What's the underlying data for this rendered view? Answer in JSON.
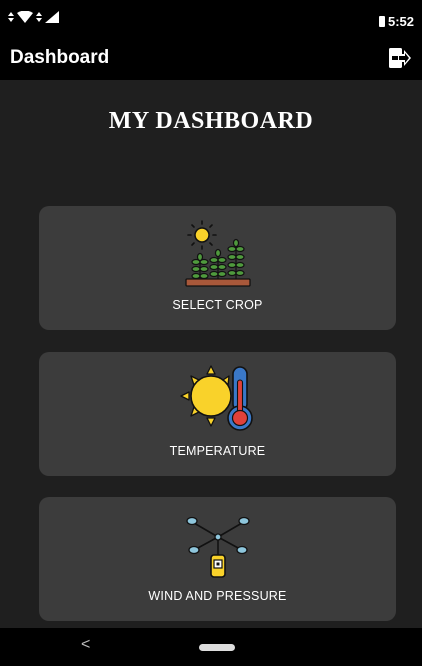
{
  "status_bar": {
    "time": "5:52",
    "icons": [
      "data-arrows-icon",
      "wifi-icon",
      "sync-icon",
      "signal-icon",
      "battery-icon"
    ]
  },
  "app_bar": {
    "title": "Dashboard",
    "logout_icon": "logout-icon"
  },
  "main": {
    "heading": "MY DASHBOARD",
    "cards": [
      {
        "label": "SELECT CROP",
        "icon": "crop-field-icon"
      },
      {
        "label": "TEMPERATURE",
        "icon": "sun-thermometer-icon"
      },
      {
        "label": "WIND AND PRESSURE",
        "icon": "wind-sensor-icon"
      }
    ]
  },
  "nav_bar": {
    "back_glyph": "<",
    "home": "home-pill"
  },
  "colors": {
    "background": "#1f1f1f",
    "bar": "#000000",
    "card": "#3c3c3c",
    "sun": "#f9d22a",
    "soil": "#a8583a",
    "leaf": "#4f9a3d",
    "thermo_blue": "#3a78c8",
    "thermo_red": "#e0413a",
    "sensor_blue": "#8ec6dc"
  }
}
